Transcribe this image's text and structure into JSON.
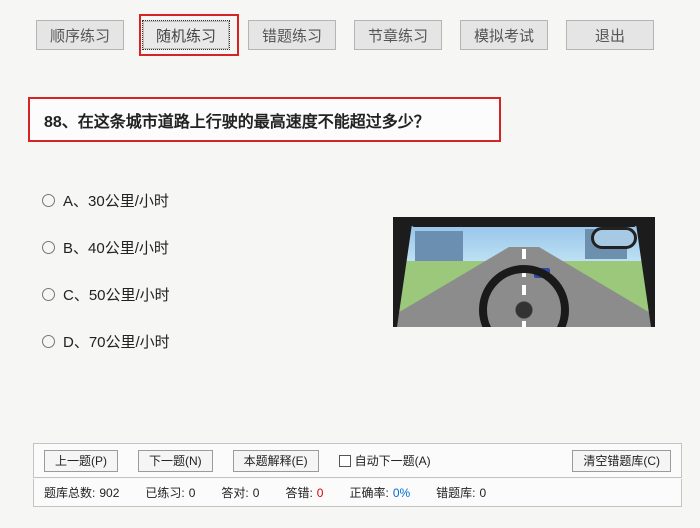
{
  "nav": {
    "items": [
      {
        "label": "顺序练习"
      },
      {
        "label": "随机练习"
      },
      {
        "label": "错题练习"
      },
      {
        "label": "节章练习"
      },
      {
        "label": "模拟考试"
      },
      {
        "label": "退出"
      }
    ],
    "active_index": 1
  },
  "question": {
    "number": "88",
    "text": "88、在这条城市道路上行驶的最高速度不能超过多少？"
  },
  "options": [
    {
      "label": "A、30公里/小时"
    },
    {
      "label": "B、40公里/小时"
    },
    {
      "label": "C、50公里/小时"
    },
    {
      "label": "D、70公里/小时"
    }
  ],
  "bottom": {
    "prev": "上一题(P)",
    "next": "下一题(N)",
    "explain": "本题解释(E)",
    "auto_next": "自动下一题(A)",
    "clear": "清空错题库(C)"
  },
  "stats": {
    "total_label": "题库总数:",
    "total_value": "902",
    "practiced_label": "已练习:",
    "practiced_value": "0",
    "correct_label": "答对:",
    "correct_value": "0",
    "wrong_label": "答错:",
    "wrong_value": "0",
    "rate_label": "正确率:",
    "rate_value": "0%",
    "wronglib_label": "错题库:",
    "wronglib_value": "0"
  }
}
